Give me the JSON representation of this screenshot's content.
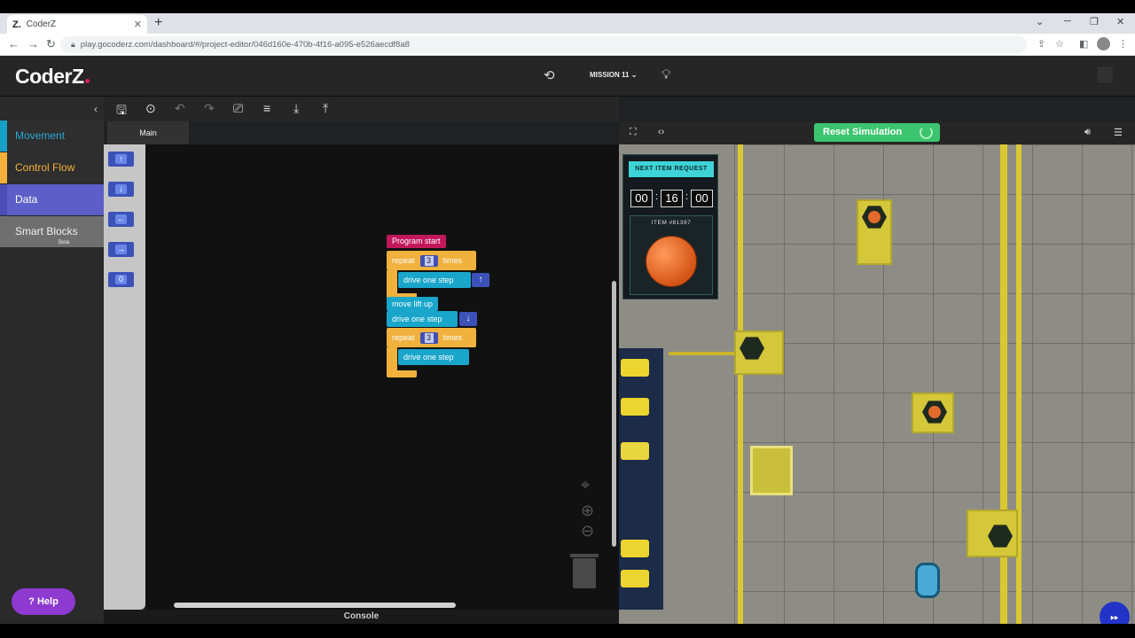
{
  "browser": {
    "tab_title": "CoderZ",
    "tab_favicon": "Z.",
    "url": "play.gocoderz.com/dashboard/#/project-editor/046d160e-470b-4f16-a095-e526aecdf8a8"
  },
  "app": {
    "logo": "CoderZ",
    "mission_label": "MISSION 11"
  },
  "categories": {
    "movement": "Movement",
    "control_flow": "Control Flow",
    "data": "Data",
    "smart_blocks": "Smart Blocks",
    "smart_blocks_badge": "Beta"
  },
  "editor": {
    "main_tab": "Main",
    "console": "Console"
  },
  "flyout": {
    "blocks": [
      "↑",
      "↓",
      "←",
      "→",
      "0"
    ]
  },
  "program": {
    "start": "Program start",
    "repeat_label": "repeat",
    "times_label": "times",
    "repeat1_count": "3",
    "repeat2_count": "3",
    "drive1": "drive one step",
    "drive1_dir": "↑",
    "lift": "move lift up",
    "drive2": "drive one step",
    "drive2_dir": "↓",
    "drive3": "drive one step"
  },
  "simulation": {
    "reset_label": "Reset Simulation",
    "request_title": "NEXT ITEM REQUEST",
    "timer": [
      "00",
      "16",
      "00"
    ],
    "item_label": "ITEM #81397"
  },
  "help": {
    "label": "Help"
  },
  "colors": {
    "movement": "#18a0c8",
    "control_flow": "#f4b03a",
    "data": "#5b5fc7",
    "program_start": "#c2185b",
    "reset_button": "#3cc46f",
    "help_button": "#8e3ad0"
  }
}
